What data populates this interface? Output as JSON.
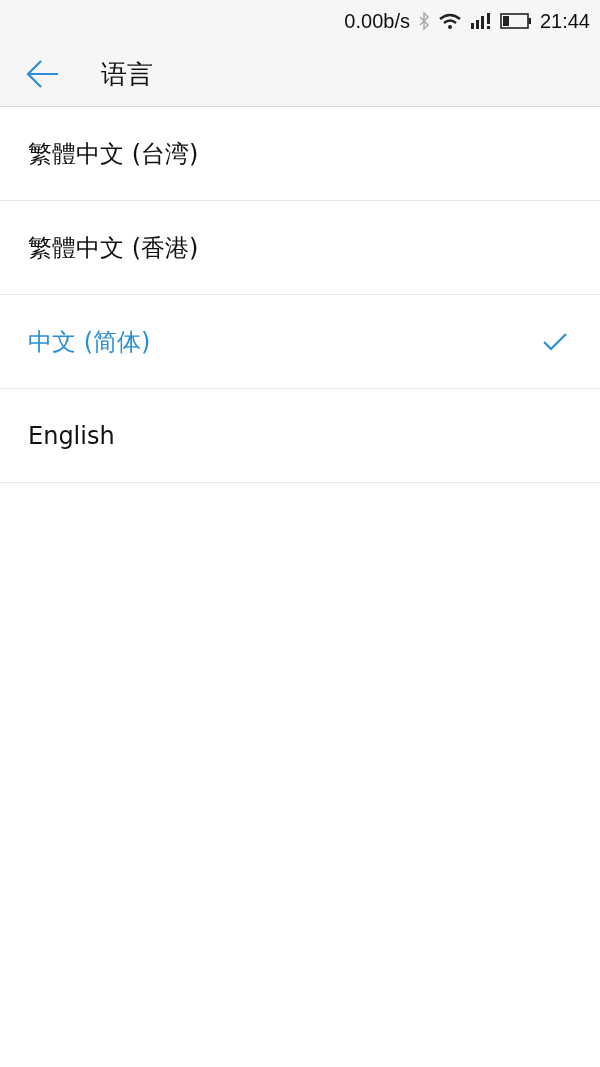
{
  "status_bar": {
    "speed": "0.00b/s",
    "time": "21:44"
  },
  "header": {
    "title": "语言"
  },
  "languages": [
    {
      "label": "繁體中文 (台湾)",
      "selected": false
    },
    {
      "label": "繁體中文 (香港)",
      "selected": false
    },
    {
      "label": "中文 (简体)",
      "selected": true
    },
    {
      "label": "English",
      "selected": false
    }
  ]
}
